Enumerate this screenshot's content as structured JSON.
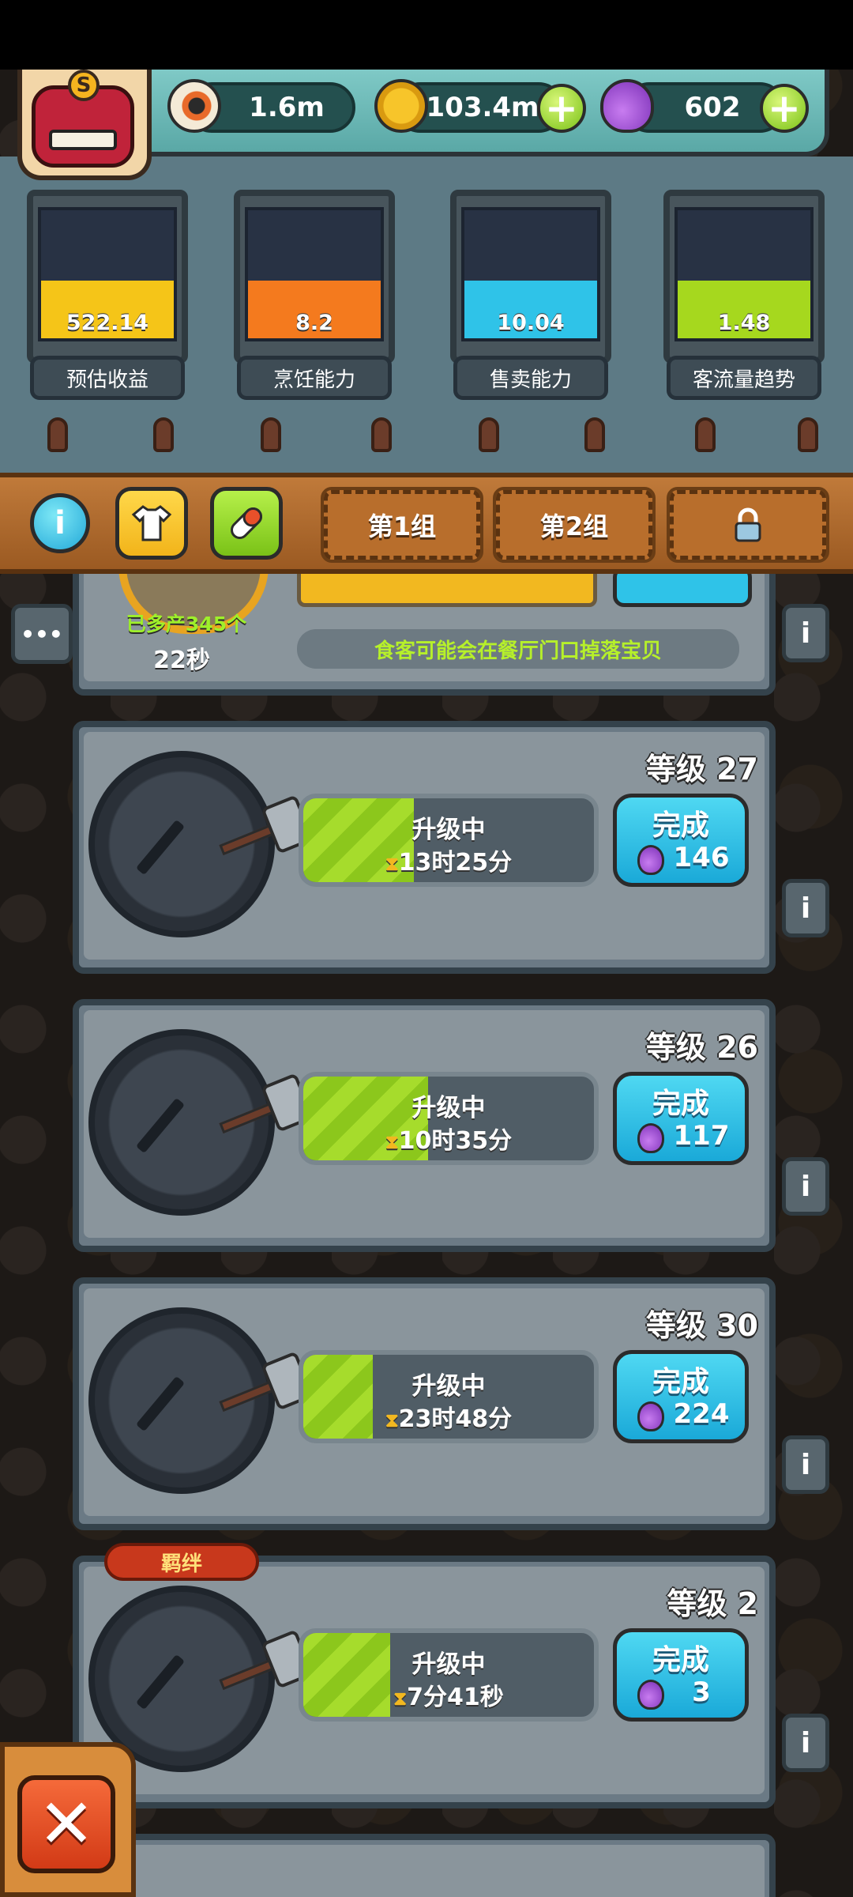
{
  "top_bar": {
    "avatar_badge": "S",
    "eyeball_value": "1.6m",
    "coin_value": "103.4m",
    "potion_value": "602",
    "coin_plus": "+",
    "potion_plus": "+"
  },
  "stats": [
    {
      "value": "522.14",
      "label": "预估收益",
      "color": "#f5c518",
      "fill": 0.45
    },
    {
      "value": "8.2",
      "label": "烹饪能力",
      "color": "#f47a1e",
      "fill": 0.45
    },
    {
      "value": "10.04",
      "label": "售卖能力",
      "color": "#2fc3e8",
      "fill": 0.45
    },
    {
      "value": "1.48",
      "label": "客流量趋势",
      "color": "#a6d81e",
      "fill": 0.45
    }
  ],
  "toolbar": {
    "info": "i",
    "tab1": "第1组",
    "tab2": "第2组",
    "lock": "🔒"
  },
  "partial_card": {
    "extra_produced": "已多产345个",
    "timer": "22秒",
    "hint": "食客可能会在餐厅门口掉落宝贝",
    "info": "i",
    "more": "•••"
  },
  "upgrades": [
    {
      "level": "等级 27",
      "status": "升级中",
      "time": "13时25分",
      "finish": "完成",
      "cost": "146",
      "progress": 0.38,
      "badge": ""
    },
    {
      "level": "等级 26",
      "status": "升级中",
      "time": "10时35分",
      "finish": "完成",
      "cost": "117",
      "progress": 0.43,
      "badge": ""
    },
    {
      "level": "等级 30",
      "status": "升级中",
      "time": "23时48分",
      "finish": "完成",
      "cost": "224",
      "progress": 0.24,
      "badge": ""
    },
    {
      "level": "等级 2",
      "status": "升级中",
      "time": "7分41秒",
      "finish": "完成",
      "cost": "3",
      "progress": 0.3,
      "badge": "羁绊"
    }
  ],
  "icons": [
    "eyeball-icon",
    "coin-icon",
    "potion-icon",
    "plus-icon",
    "info-icon",
    "shirt-icon",
    "pill-icon",
    "lock-icon",
    "hourglass-icon",
    "close-icon"
  ],
  "close": "✕"
}
